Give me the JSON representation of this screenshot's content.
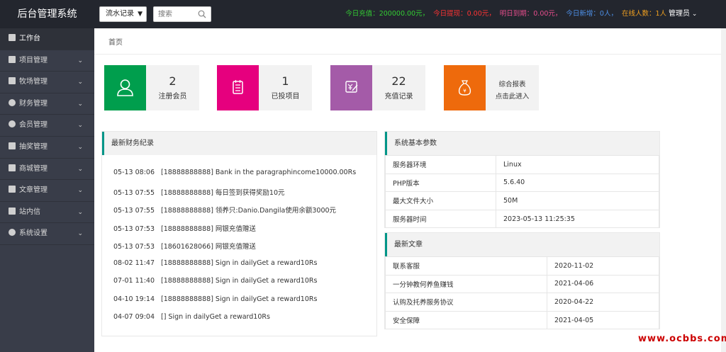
{
  "app": {
    "title": "后台管理系统"
  },
  "toolbar": {
    "select_value": "流水记录",
    "search_placeholder": "搜索"
  },
  "stats": [
    {
      "text": "今日充值：200000.00元，",
      "color": "#33cc33"
    },
    {
      "text": "今日提现：0.00元，",
      "color": "#ff3333"
    },
    {
      "text": "明日到期：0.00元，",
      "color": "#e64d8c"
    },
    {
      "text": "今日新增：0人，",
      "color": "#4d8fe6"
    },
    {
      "text": "在线人数：1人",
      "color": "#f0a020"
    }
  ],
  "admin_label": "管理员",
  "sidebar": {
    "items": [
      {
        "label": "工作台"
      },
      {
        "label": "项目管理"
      },
      {
        "label": "牧场管理"
      },
      {
        "label": "财务管理"
      },
      {
        "label": "会员管理"
      },
      {
        "label": "抽奖管理"
      },
      {
        "label": "商城管理"
      },
      {
        "label": "文章管理"
      },
      {
        "label": "站内信"
      },
      {
        "label": "系统设置"
      }
    ]
  },
  "breadcrumb": "首页",
  "cards": [
    {
      "value": "2",
      "label": "注册会员",
      "color": "#009e4d",
      "icon": "user-icon"
    },
    {
      "value": "1",
      "label": "已投项目",
      "color": "#e6007e",
      "icon": "clipboard-icon"
    },
    {
      "value": "22",
      "label": "充值记录",
      "color": "#a45ba8",
      "icon": "recharge-icon"
    },
    {
      "line1": "综合报表",
      "line2": "点击此进入",
      "color": "#ee6a0c",
      "icon": "money-bag-icon"
    }
  ],
  "finance": {
    "title": "最新财务纪录",
    "records": [
      {
        "time": "05-13 08:06",
        "text": "[18888888888] Bank in the paragraphincome10000.00Rs"
      },
      {
        "time": "05-13 07:55",
        "text": "[18888888888] 每日签到获得奖励10元"
      },
      {
        "time": "05-13 07:55",
        "text": "[18888888888] 领养只:Danio.Dangila使用余额3000元"
      },
      {
        "time": "05-13 07:53",
        "text": "[18888888888] 网银充值赠送"
      },
      {
        "time": "05-13 07:53",
        "text": "[18601628066] 网银充值赠送"
      },
      {
        "time": "08-02 11:47",
        "text": "[18888888888] Sign in dailyGet a reward10Rs"
      },
      {
        "time": "07-01 11:40",
        "text": "[18888888888] Sign in dailyGet a reward10Rs"
      },
      {
        "time": "04-10 19:14",
        "text": "[18888888888] Sign in dailyGet a reward10Rs"
      },
      {
        "time": "04-07 09:04",
        "text": "[] Sign in dailyGet a reward10Rs"
      }
    ]
  },
  "system": {
    "title": "系统基本参数",
    "rows": [
      {
        "key": "服务器环境",
        "value": "Linux"
      },
      {
        "key": "PHP版本",
        "value": "5.6.40"
      },
      {
        "key": "最大文件大小",
        "value": "50M"
      },
      {
        "key": "服务器时间",
        "value": "2023-05-13 11:25:35"
      }
    ]
  },
  "articles": {
    "title": "最新文章",
    "rows": [
      {
        "title": "联系客服",
        "date": "2020-11-02"
      },
      {
        "title": "一分钟教何养鱼赚钱",
        "date": "2021-04-06"
      },
      {
        "title": "认购及托养服务协议",
        "date": "2020-04-22"
      },
      {
        "title": "安全保障",
        "date": "2021-04-05"
      }
    ]
  },
  "watermark": "www.ocbbs.com"
}
